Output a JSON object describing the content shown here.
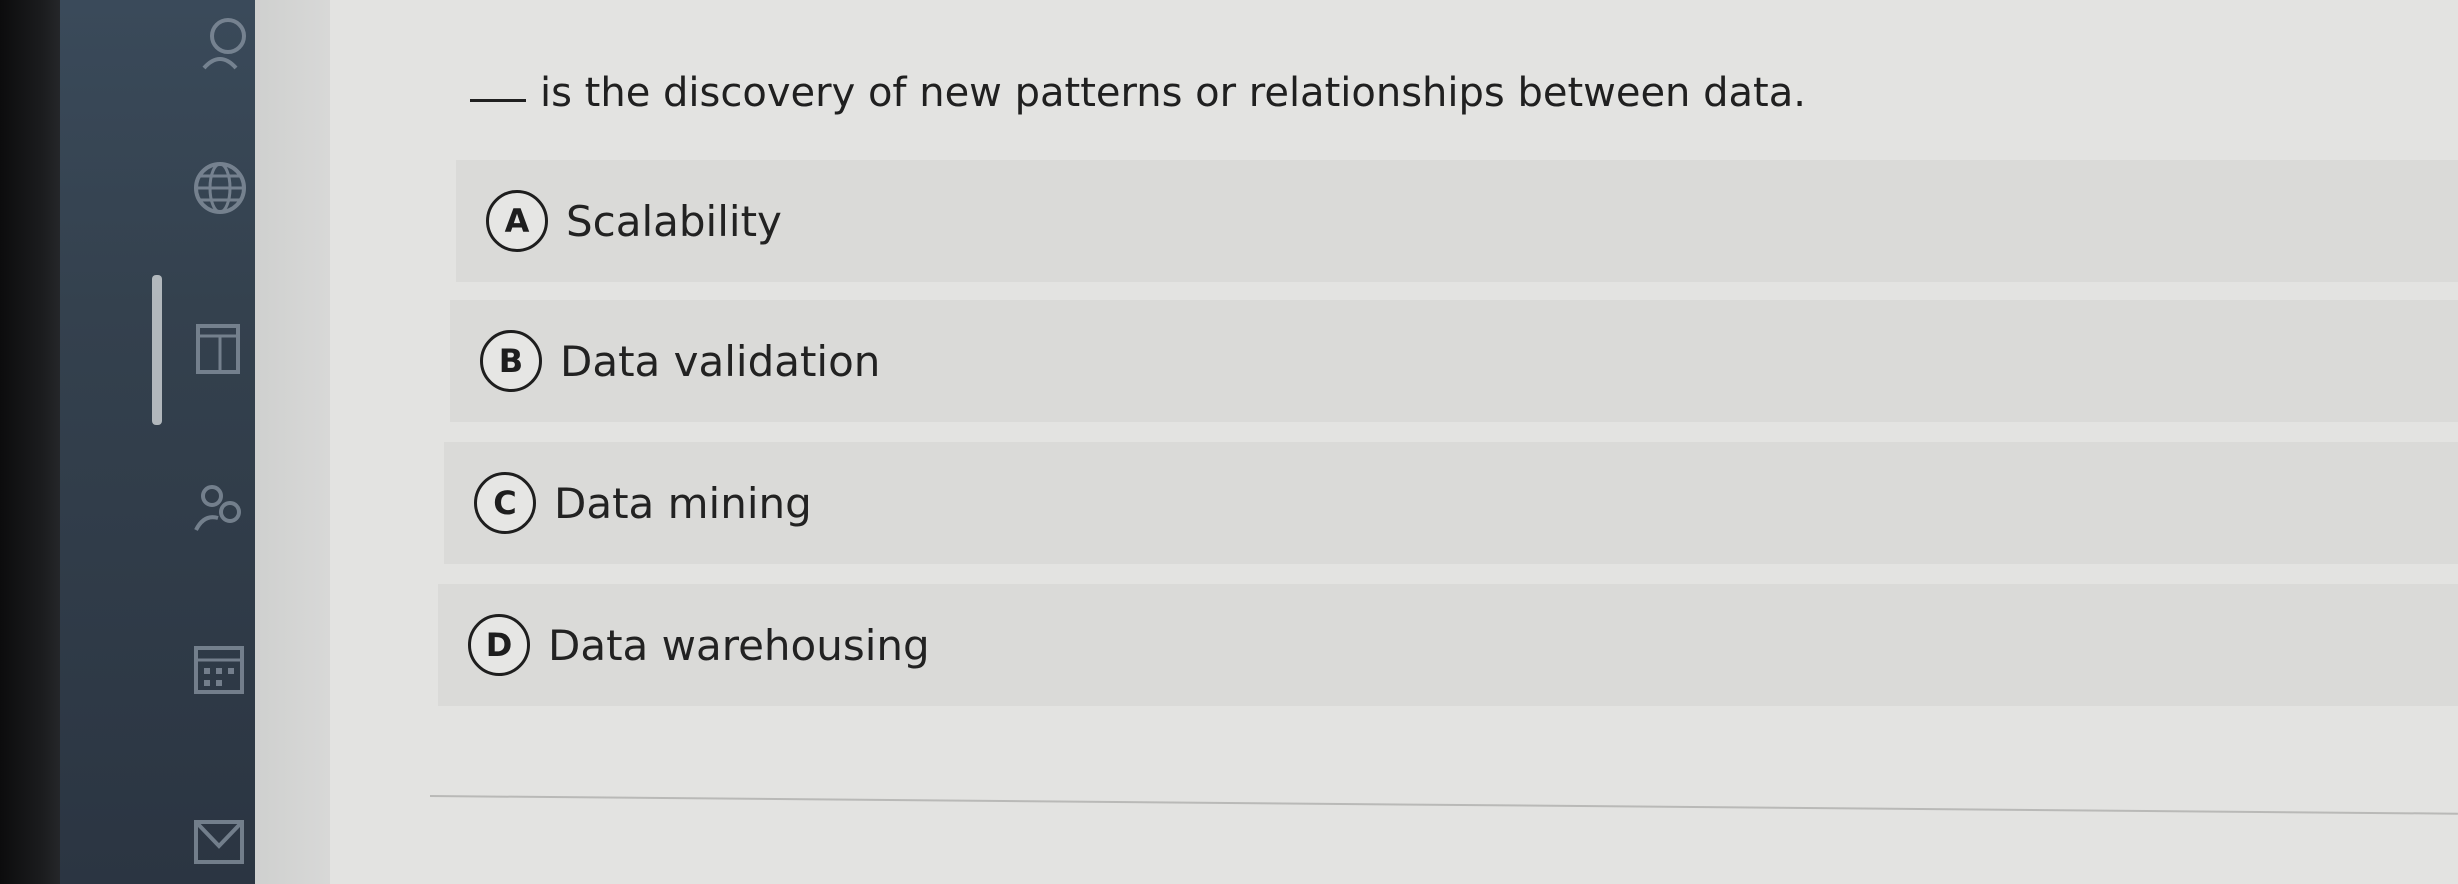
{
  "question": {
    "text": "is the discovery of new patterns or relationships between data."
  },
  "options": [
    {
      "letter": "A",
      "label": "Scalability"
    },
    {
      "letter": "B",
      "label": "Data validation"
    },
    {
      "letter": "C",
      "label": "Data mining"
    },
    {
      "letter": "D",
      "label": "Data warehousing"
    }
  ],
  "sidebar": {
    "icons": [
      "profile-icon",
      "globe-icon",
      "book-icon",
      "people-icon",
      "calendar-icon",
      "mail-icon"
    ]
  }
}
